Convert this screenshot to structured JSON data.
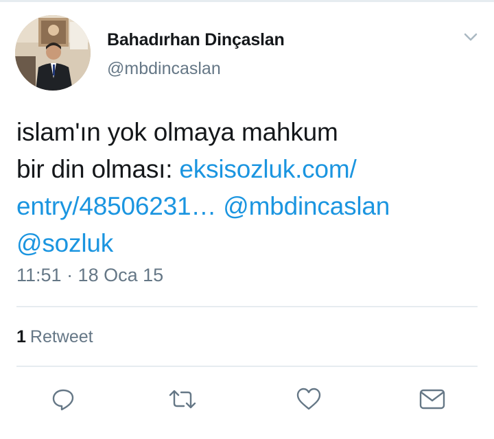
{
  "tweet": {
    "author": {
      "display_name": "Bahadırhan Dinçaslan",
      "handle": "@mbdincaslan"
    },
    "text_lines": [
      [
        "islam'ın yok olmaya mahkum"
      ],
      [
        "bir din olması: ",
        "eksisozluk.com/"
      ],
      [
        "entry/48506231…",
        " ",
        "@mbdincaslan"
      ],
      [
        "@sozluk"
      ]
    ],
    "link_text_1": "eksisozluk.com/",
    "link_text_2": "entry/48506231…",
    "mention_1": "@mbdincaslan",
    "mention_2": "@sozluk",
    "line_1": "islam'ın yok olmaya mahkum",
    "line_2_plain": "bir din olması: ",
    "timestamp": "11:51 · 18 Oca 15",
    "retweet_count": "1",
    "retweet_label": "Retweet"
  },
  "icons": {
    "menu": "chevron-down-icon",
    "reply": "reply-icon",
    "retweet": "retweet-icon",
    "like": "heart-icon",
    "dm": "envelope-icon"
  },
  "colors": {
    "text": "#14171a",
    "secondary": "#657786",
    "link": "#1b95e0",
    "divider": "#e6ecf0"
  }
}
